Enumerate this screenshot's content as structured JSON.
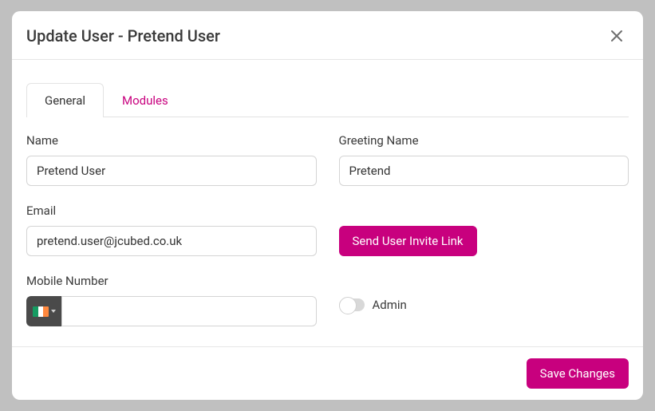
{
  "modal": {
    "title": "Update User - Pretend User"
  },
  "tabs": {
    "general": "General",
    "modules": "Modules"
  },
  "form": {
    "name_label": "Name",
    "name_value": "Pretend User",
    "greeting_label": "Greeting Name",
    "greeting_value": "Pretend",
    "email_label": "Email",
    "email_value": "pretend.user@jcubed.co.uk",
    "mobile_label": "Mobile Number",
    "mobile_value": "",
    "invite_button": "Send User Invite Link",
    "admin_label": "Admin"
  },
  "footer": {
    "save": "Save Changes"
  }
}
